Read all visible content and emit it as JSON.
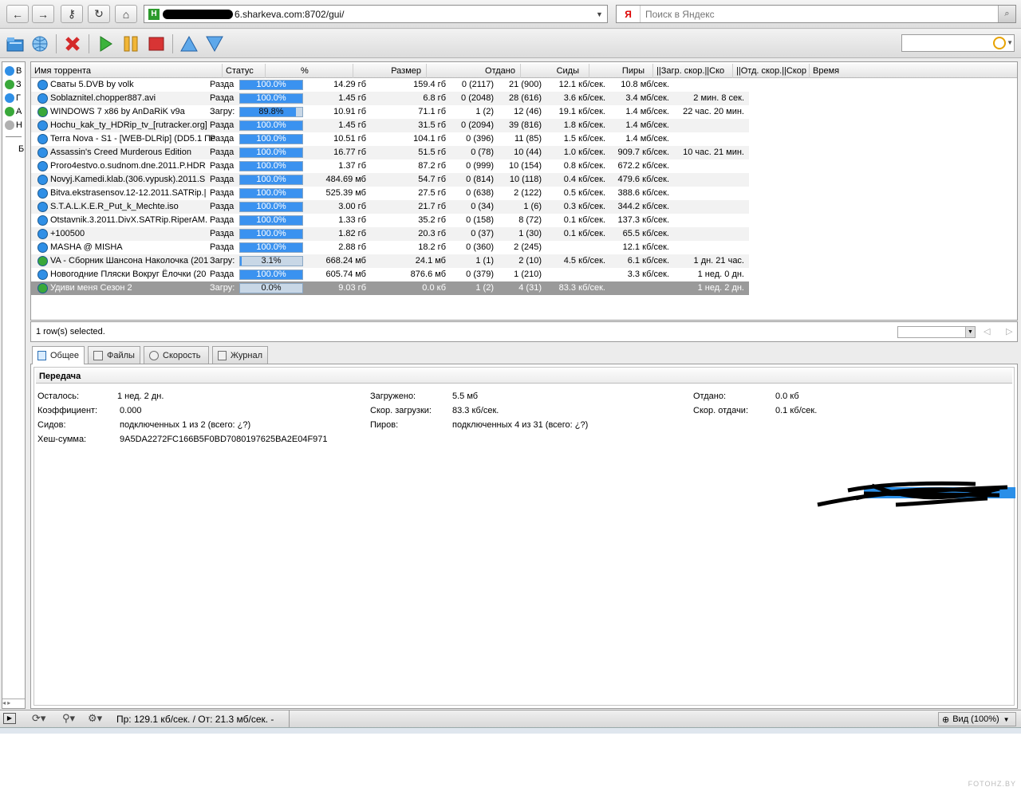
{
  "browser": {
    "url_text": "6.sharkeva.com:8702/gui/",
    "search_placeholder": "Поиск в Яндекс",
    "search_engine_glyph": "Я"
  },
  "sidebar": {
    "items": [
      {
        "label": "В",
        "color": "#2f8fe6"
      },
      {
        "label": "З",
        "color": "#39a83a"
      },
      {
        "label": "Г",
        "color": "#2f8fe6"
      },
      {
        "label": "А",
        "color": "#39a83a"
      },
      {
        "label": "Н",
        "color": "#b0b0b0"
      },
      {
        "label": "Б",
        "color": ""
      }
    ]
  },
  "list": {
    "columns": [
      "Имя торрента",
      "Статус",
      "%",
      "Размер",
      "Отдано",
      "Сиды",
      "Пиры",
      "||Загр. скор.||Ско",
      "||Отд. скор.||Скор",
      "Время"
    ],
    "rows": [
      {
        "name": "Сваты 5.DVB by volk",
        "status": "Разда",
        "pct": "100.0%",
        "progress": 100,
        "size": "14.29 гб",
        "uploaded": "159.4 гб",
        "seeds": "0 (2117)",
        "peers": "21 (900)",
        "down": "12.1 кб/сек.",
        "up": "10.8 мб/сек.",
        "eta": "",
        "icon": "blue"
      },
      {
        "name": "Soblaznitel.chopper887.avi",
        "status": "Разда",
        "pct": "100.0%",
        "progress": 100,
        "size": "1.45 гб",
        "uploaded": "6.8 гб",
        "seeds": "0 (2048)",
        "peers": "28 (616)",
        "down": "3.6 кб/сек.",
        "up": "3.4 мб/сек.",
        "eta": "2 мин. 8 сек.",
        "icon": "blue"
      },
      {
        "name": "WINDOWS 7 x86 by AnDaRiK v9a",
        "status": "Загру:",
        "pct": "89.8%",
        "progress": 89.8,
        "size": "10.91 гб",
        "uploaded": "71.1 гб",
        "seeds": "1 (2)",
        "peers": "12 (46)",
        "down": "19.1 кб/сек.",
        "up": "1.4 мб/сек.",
        "eta": "22 час. 20 мин.",
        "icon": "green"
      },
      {
        "name": "Hochu_kak_ty_HDRip_tv_[rutracker.org]",
        "status": "Разда",
        "pct": "100.0%",
        "progress": 100,
        "size": "1.45 гб",
        "uploaded": "31.5 гб",
        "seeds": "0 (2094)",
        "peers": "39 (816)",
        "down": "1.8 кб/сек.",
        "up": "1.4 мб/сек.",
        "eta": "",
        "icon": "blue"
      },
      {
        "name": "Terra Nova - S1 - [WEB-DLRip] (DD5.1 Пе",
        "status": "Разда",
        "pct": "100.0%",
        "progress": 100,
        "size": "10.51 гб",
        "uploaded": "104.1 гб",
        "seeds": "0 (396)",
        "peers": "11 (85)",
        "down": "1.5 кб/сек.",
        "up": "1.4 мб/сек.",
        "eta": "",
        "icon": "blue"
      },
      {
        "name": "Assassin's Creed Murderous Edition",
        "status": "Разда",
        "pct": "100.0%",
        "progress": 100,
        "size": "16.77 гб",
        "uploaded": "51.5 гб",
        "seeds": "0 (78)",
        "peers": "10 (44)",
        "down": "1.0 кб/сек.",
        "up": "909.7 кб/сек.",
        "eta": "10 час. 21 мин.",
        "icon": "blue"
      },
      {
        "name": "Proro4estvo.o.sudnom.dne.2011.P.HDR",
        "status": "Разда",
        "pct": "100.0%",
        "progress": 100,
        "size": "1.37 гб",
        "uploaded": "87.2 гб",
        "seeds": "0 (999)",
        "peers": "10 (154)",
        "down": "0.8 кб/сек.",
        "up": "672.2 кб/сек.",
        "eta": "",
        "icon": "blue"
      },
      {
        "name": "Novyj.Kamedi.klab.(306.vypusk).2011.S",
        "status": "Разда",
        "pct": "100.0%",
        "progress": 100,
        "size": "484.69 мб",
        "uploaded": "54.7 гб",
        "seeds": "0 (814)",
        "peers": "10 (118)",
        "down": "0.4 кб/сек.",
        "up": "479.6 кб/сек.",
        "eta": "",
        "icon": "blue"
      },
      {
        "name": "Bitva.ekstrasensov.12-12.2011.SATRip.|",
        "status": "Разда",
        "pct": "100.0%",
        "progress": 100,
        "size": "525.39 мб",
        "uploaded": "27.5 гб",
        "seeds": "0 (638)",
        "peers": "2 (122)",
        "down": "0.5 кб/сек.",
        "up": "388.6 кб/сек.",
        "eta": "",
        "icon": "blue"
      },
      {
        "name": "S.T.A.L.K.E.R_Put_k_Mechte.iso",
        "status": "Разда",
        "pct": "100.0%",
        "progress": 100,
        "size": "3.00 гб",
        "uploaded": "21.7 гб",
        "seeds": "0 (34)",
        "peers": "1 (6)",
        "down": "0.3 кб/сек.",
        "up": "344.2 кб/сек.",
        "eta": "",
        "icon": "blue"
      },
      {
        "name": "Otstavnik.3.2011.DivX.SATRip.RiperAM.",
        "status": "Разда",
        "pct": "100.0%",
        "progress": 100,
        "size": "1.33 гб",
        "uploaded": "35.2 гб",
        "seeds": "0 (158)",
        "peers": "8 (72)",
        "down": "0.1 кб/сек.",
        "up": "137.3 кб/сек.",
        "eta": "",
        "icon": "blue"
      },
      {
        "name": "+100500",
        "status": "Разда",
        "pct": "100.0%",
        "progress": 100,
        "size": "1.82 гб",
        "uploaded": "20.3 гб",
        "seeds": "0 (37)",
        "peers": "1 (30)",
        "down": "0.1 кб/сек.",
        "up": "65.5 кб/сек.",
        "eta": "",
        "icon": "blue"
      },
      {
        "name": "MASHA @ MISHA",
        "status": "Разда",
        "pct": "100.0%",
        "progress": 100,
        "size": "2.88 гб",
        "uploaded": "18.2 гб",
        "seeds": "0 (360)",
        "peers": "2 (245)",
        "down": "",
        "up": "12.1 кб/сек.",
        "eta": "",
        "icon": "blue"
      },
      {
        "name": "VA - Сборник Шансона Наколочка (201",
        "status": "Загру:",
        "pct": "3.1%",
        "progress": 3.1,
        "size": "668.24 мб",
        "uploaded": "24.1 мб",
        "seeds": "1 (1)",
        "peers": "2 (10)",
        "down": "4.5 кб/сек.",
        "up": "6.1 кб/сек.",
        "eta": "1 дн. 21 час.",
        "icon": "green"
      },
      {
        "name": "Новогодние Пляски Вокруг Ёлочки (20",
        "status": "Разда",
        "pct": "100.0%",
        "progress": 100,
        "size": "605.74 мб",
        "uploaded": "876.6 мб",
        "seeds": "0 (379)",
        "peers": "1 (210)",
        "down": "",
        "up": "3.3 кб/сек.",
        "eta": "1 нед. 0 дн.",
        "icon": "blue"
      },
      {
        "name": "Удиви меня Сезон 2",
        "status": "Загру:",
        "pct": "0.0%",
        "progress": 0,
        "size": "9.03 гб",
        "uploaded": "0.0 кб",
        "seeds": "1 (2)",
        "peers": "4 (31)",
        "down": "83.3 кб/сек.",
        "up": "",
        "eta": "1 нед. 2 дн.",
        "icon": "green",
        "selected": true
      }
    ]
  },
  "statusline": {
    "message": "1 row(s) selected."
  },
  "tabs": [
    {
      "label": "Общее",
      "active": true
    },
    {
      "label": "Файлы",
      "active": false
    },
    {
      "label": "Скорость",
      "active": false
    },
    {
      "label": "Журнал",
      "active": false
    }
  ],
  "details": {
    "section_title": "Передача",
    "remaining_label": "Осталось:",
    "remaining_value": "1 нед. 2 дн.",
    "ratio_label": "Коэффициент:",
    "ratio_value": "0.000",
    "seeds_label": "Сидов:",
    "seeds_value": "подключенных 1 из 2 (всего: ¿?)",
    "hash_label": "Хеш-сумма:",
    "hash_value": "9A5DA2272FC166B5F0BD7080197625BA2E04F971",
    "downloaded_label": "Загружено:",
    "downloaded_value": "5.5 мб",
    "dlspeed_label": "Скор. загрузки:",
    "dlspeed_value": "83.3 кб/сек.",
    "peers_label": "Пиров:",
    "peers_value": "подключенных 4 из 31 (всего: ¿?)",
    "uploaded_label": "Отдано:",
    "uploaded_value": "0.0 кб",
    "ulspeed_label": "Скор. отдачи:",
    "ulspeed_value": "0.1 кб/сек."
  },
  "bottom_status": {
    "speed_text": "Пр: 129.1 кб/сек. / От: 21.3 мб/сек.  -",
    "zoom_text": "Вид (100%)"
  },
  "watermark": "FOTOHZ.BY",
  "colors": {
    "progress_fill": "#3a92f0",
    "selected_row": "#9a9a9a",
    "row_stripe": "#f2f2f2"
  }
}
